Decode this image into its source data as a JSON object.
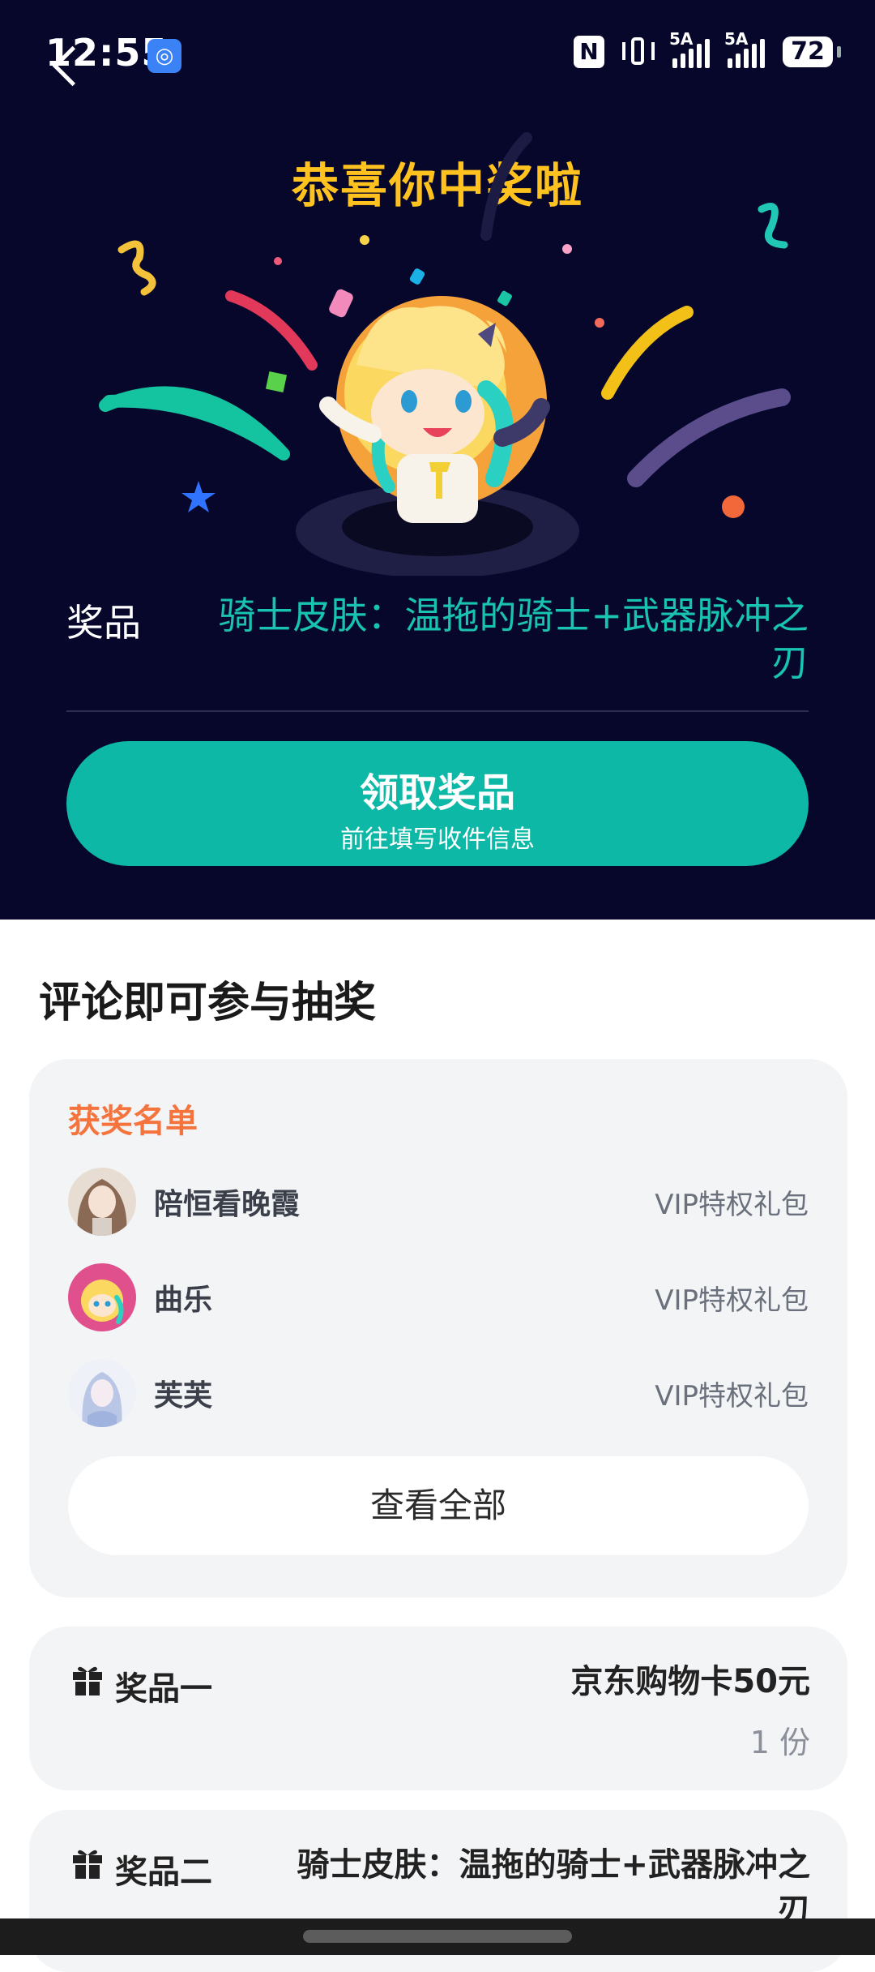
{
  "status_bar": {
    "time": "12:55",
    "nfc": "N",
    "signal_1": "5A",
    "signal_2": "5A",
    "battery": "72"
  },
  "hero": {
    "title": "恭喜你中奖啦",
    "prize_label": "奖品",
    "prize_value": "骑士皮肤：温拖的骑士+武器脉冲之刃",
    "claim_title": "领取奖品",
    "claim_subtitle": "前往填写收件信息",
    "background_color": "#07072b",
    "accent_color": "#0db9a6"
  },
  "section_title": "评论即可参与抽奖",
  "winners": {
    "title": "获奖名单",
    "list": [
      {
        "name": "陪恒看晚霞",
        "prize": "VIP特权礼包",
        "avatar": "girl-avatar"
      },
      {
        "name": "曲乐",
        "prize": "VIP特权礼包",
        "avatar": "mascot-avatar"
      },
      {
        "name": "芙芙",
        "prize": "VIP特权礼包",
        "avatar": "anime-avatar"
      }
    ],
    "view_all": "查看全部"
  },
  "prizes": [
    {
      "name": "奖品一",
      "desc": "京东购物卡50元",
      "qty": "1 份"
    },
    {
      "name": "奖品二",
      "desc": "骑士皮肤：温拖的骑士+武器脉冲之刃"
    }
  ]
}
